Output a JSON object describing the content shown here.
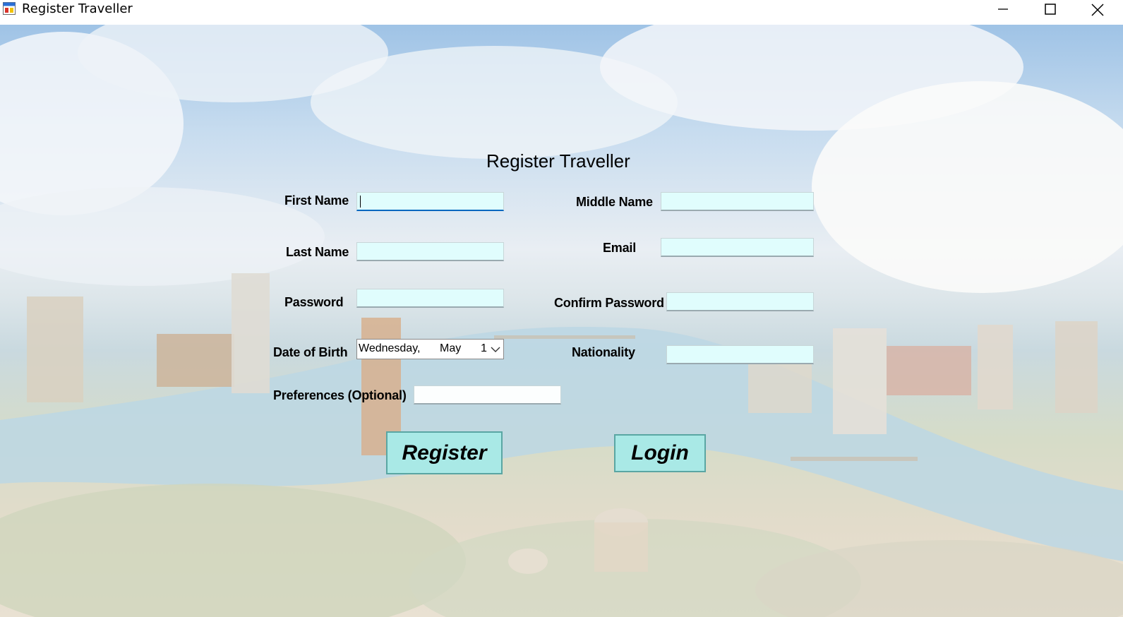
{
  "window": {
    "title": "Register Traveller",
    "app_icon": "form-window-icon",
    "controls": [
      "minimize-icon",
      "maximize-icon",
      "close-icon"
    ]
  },
  "form": {
    "heading": "Register Traveller",
    "fields": {
      "first_name": {
        "label": "First Name",
        "value": ""
      },
      "middle_name": {
        "label": "Middle Name",
        "value": ""
      },
      "last_name": {
        "label": "Last Name",
        "value": ""
      },
      "email": {
        "label": "Email",
        "value": ""
      },
      "password": {
        "label": "Password",
        "value": ""
      },
      "confirm_password": {
        "label": "Confirm Password",
        "value": ""
      },
      "date_of_birth": {
        "label": "Date of Birth",
        "weekday": "Wednesday,",
        "month": "May",
        "day": "1"
      },
      "nationality": {
        "label": "Nationality",
        "value": ""
      },
      "preferences": {
        "label": "Preferences (Optional)",
        "value": ""
      }
    },
    "buttons": {
      "register": "Register",
      "login": "Login"
    }
  },
  "colors": {
    "input_bg": "#e0fdfd",
    "button_bg": "#a9e9e6",
    "button_border": "#5aa6a3"
  }
}
